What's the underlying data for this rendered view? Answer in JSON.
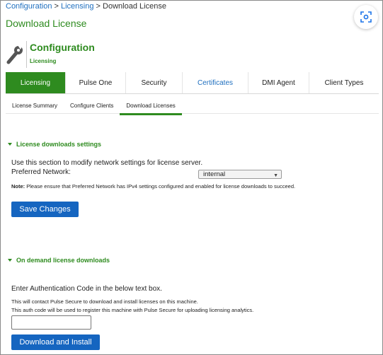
{
  "breadcrumb": {
    "items": [
      "Configuration",
      "Licensing",
      "Download License"
    ],
    "separator": ">"
  },
  "page_title": "Download License",
  "header": {
    "title": "Configuration",
    "subtitle": "Licensing",
    "icon": "wrench-icon"
  },
  "tabs": [
    {
      "label": "Licensing",
      "active": true
    },
    {
      "label": "Pulse One",
      "active": false
    },
    {
      "label": "Security",
      "active": false
    },
    {
      "label": "Certificates",
      "active": false
    },
    {
      "label": "DMI Agent",
      "active": false
    },
    {
      "label": "Client Types",
      "active": false
    }
  ],
  "subtabs": [
    {
      "label": "License Summary",
      "active": false
    },
    {
      "label": "Configure Clients",
      "active": false
    },
    {
      "label": "Download Licenses",
      "active": true
    }
  ],
  "settings": {
    "heading": "License downloads settings",
    "description": "Use this section to modify network settings for license server.",
    "preferred_network_label": "Preferred Network:",
    "preferred_network_value": "internal",
    "note_label": "Note:",
    "note_text": "Please ensure that Preferred Network has IPv4 settings configured and enabled for license downloads to succeed.",
    "save_label": "Save Changes"
  },
  "on_demand": {
    "heading": "On demand license downloads",
    "instruction": "Enter Authentication Code in the below text box.",
    "info_1": "This will contact Pulse Secure to download and install licenses on this machine.",
    "info_2": "This auth code will be used to register this machine with Pulse Secure for uploading licensing analytics.",
    "auth_code_value": "",
    "download_label": "Download and Install"
  },
  "colors": {
    "accent_green": "#2e8b1f",
    "link_blue": "#1f6fbf",
    "button_blue": "#1565c0"
  }
}
